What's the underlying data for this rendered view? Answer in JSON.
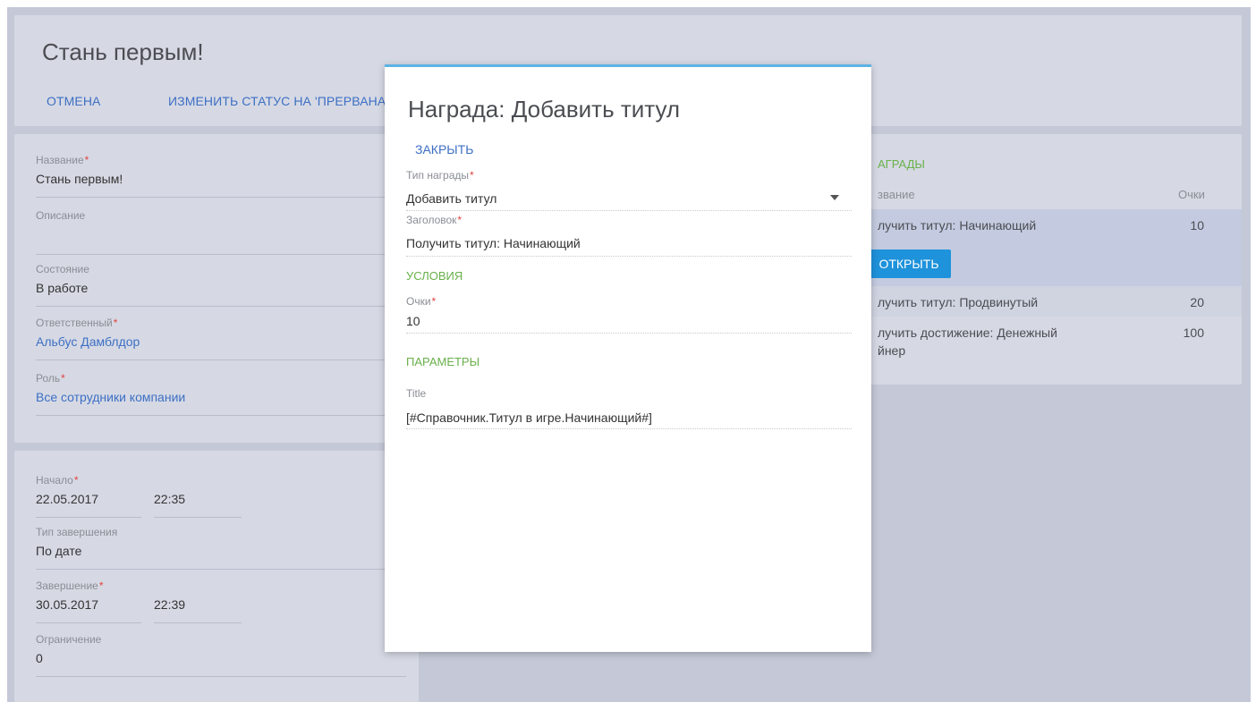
{
  "header": {
    "title": "Стань первым!",
    "actions": {
      "cancel": "ОТМЕНА",
      "change_status": "ИЗМЕНИТЬ СТАТУС НА 'ПРЕРВАНА"
    }
  },
  "form": {
    "name": {
      "label": "Название",
      "value": "Стань первым!"
    },
    "description": {
      "label": "Описание",
      "value": ""
    },
    "state": {
      "label": "Состояние",
      "value": "В работе"
    },
    "responsible": {
      "label": "Ответственный",
      "value": "Альбус Дамблдор"
    },
    "role": {
      "label": "Роль",
      "value": "Все сотрудники компании"
    },
    "required_mark": "*"
  },
  "schedule": {
    "start": {
      "label": "Начало",
      "date": "22.05.2017",
      "time": "22:35"
    },
    "end_type": {
      "label": "Тип завершения",
      "value": "По дате"
    },
    "end": {
      "label": "Завершение",
      "date": "30.05.2017",
      "time": "22:39"
    },
    "limit": {
      "label": "Ограничение",
      "value": "0"
    }
  },
  "rewards": {
    "section": "АГРАДЫ",
    "col_name": "звание",
    "col_points": "Очки",
    "open_button": "ОТКРЫТЬ",
    "rows": [
      {
        "name": "лучить титул: Начинающий",
        "points": "10"
      },
      {
        "name": "лучить титул: Продвинутый",
        "points": "20"
      },
      {
        "name": "лучить достижение: Денежный",
        "name2": "йнер",
        "points": "100"
      }
    ]
  },
  "modal": {
    "title": "Награда: Добавить титул",
    "close": "ЗАКРЫТЬ",
    "reward_type": {
      "label": "Тип награды",
      "value": "Добавить титул"
    },
    "heading": {
      "label": "Заголовок",
      "value": "Получить титул: Начинающий"
    },
    "conditions_section": "УСЛОВИЯ",
    "points": {
      "label": "Очки",
      "value": "10"
    },
    "params_section": "ПАРАМЕТРЫ",
    "title_param": {
      "label": "Title",
      "value": "[#Справочник.Титул в игре.Начинающий#]"
    }
  },
  "colors": {
    "accent_blue": "#3d6fc4",
    "section_green": "#69b04a",
    "required_red": "#e0433e",
    "button_blue": "#1e92db",
    "modal_top_border": "#5eb3e4"
  }
}
